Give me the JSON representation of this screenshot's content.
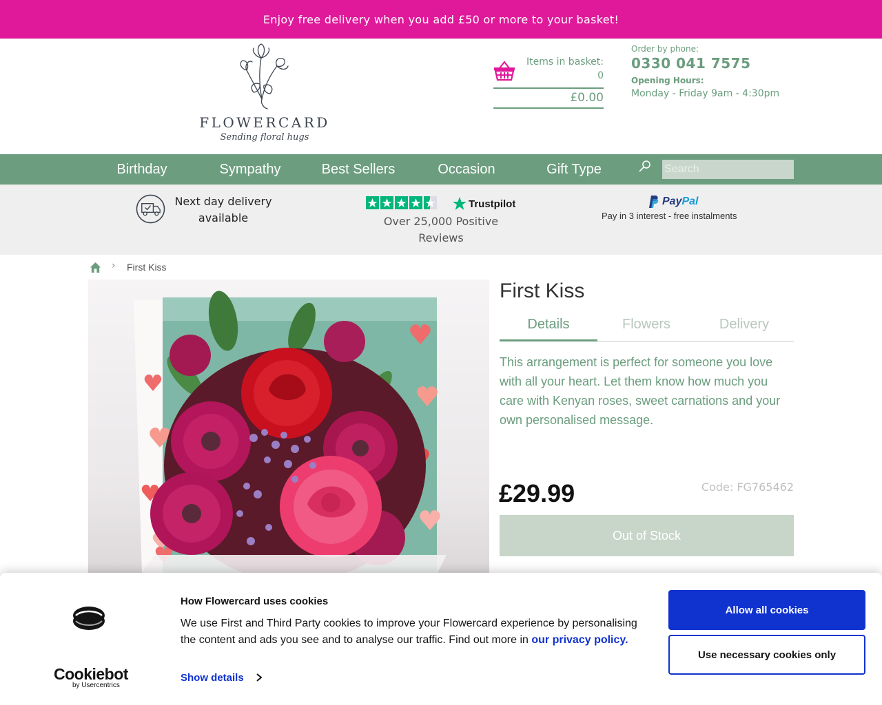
{
  "promo": {
    "text": "Enjoy free delivery when you add £50 or more to your basket!"
  },
  "colors": {
    "promo_pink": "#e0199a",
    "brand_green": "#6b9d7e",
    "cookie_blue": "#1032cf",
    "out_of_stock_bg": "#c8d5c9"
  },
  "header": {
    "logo_word": "FLOWERCARD",
    "logo_tagline": "Sending floral hugs",
    "basket": {
      "label": "Items in basket:",
      "count": "0",
      "total": "£0.00",
      "icon": "basket-icon"
    },
    "contact": {
      "order_label": "Order by phone:",
      "phone": "0330 041 7575",
      "hours_label": "Opening Hours:",
      "hours": "Monday - Friday 9am - 4:30pm"
    }
  },
  "nav": {
    "items": [
      {
        "label": "Birthday"
      },
      {
        "label": "Sympathy"
      },
      {
        "label": "Best Sellers"
      },
      {
        "label": "Occasion"
      },
      {
        "label": "Gift Type"
      }
    ],
    "search_placeholder": "Search",
    "search_icon": "search-icon"
  },
  "usps": {
    "delivery": "Next day delivery available",
    "delivery_icon": "delivery-truck-icon",
    "trustpilot_brand": "Trustpilot",
    "trustpilot_text": "Over 25,000 Positive Reviews",
    "paypal_pay": "Pay",
    "paypal_pal": "Pal",
    "paypal_text": "Pay in 3 interest - free instalments"
  },
  "breadcrumb": {
    "separator": "›",
    "current": "First Kiss",
    "home_icon": "home-icon"
  },
  "product": {
    "title": "First Kiss",
    "tabs": [
      {
        "label": "Details"
      },
      {
        "label": "Flowers"
      },
      {
        "label": "Delivery"
      }
    ],
    "active_tab": "Details",
    "description": "This arrangement is perfect for someone you love with all your heart. Let them know how much you care with Kenyan roses, sweet carnations and your own personalised message.",
    "price": "£29.99",
    "code": "Code: FG765462",
    "stock_button": "Out of Stock"
  },
  "cookie": {
    "brand_word": "Cookiebot",
    "brand_sub": "by Usercentrics",
    "title": "How Flowercard uses cookies",
    "text": "We use First and Third Party cookies to improve your Flowercard experience by personalising the content and ads you see and to analyse our traffic. Find out more in",
    "link": "our privacy policy.",
    "show_details": "Show details",
    "allow_all": "Allow all cookies",
    "necessary_only": "Use necessary cookies only"
  }
}
